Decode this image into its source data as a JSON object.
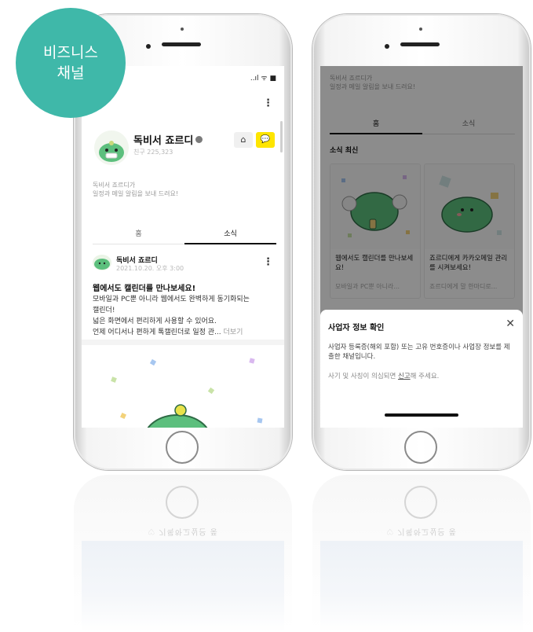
{
  "badge": {
    "line1": "비즈니스",
    "line2": "채널"
  },
  "left_phone": {
    "status_icons": "..ıl ᯤ ■",
    "menu_icon": "⋮",
    "channel": {
      "name": "독비서 죠르디",
      "friends": "친구 225,323",
      "home_button": "⌂",
      "chat_button": "💬"
    },
    "description": {
      "line1": "독비서 죠르디가",
      "line2": "일정과 메일 알림을 보내 드려요!"
    },
    "tabs": [
      "홈",
      "소식"
    ],
    "active_tab": "소식",
    "post": {
      "author": "독비서 죠르디",
      "date": "2021.10.20. 오후 3:00",
      "menu": "⋮",
      "title": "웹에서도 캘린더를 만나보세요!",
      "body_line1": "모바일과 PC뿐 아니라 웹에서도 완벽하게 동기화되는",
      "body_line2": "캘린더!",
      "body_line3": "넓은 화면에서 편리하게 사용할 수 있어요.",
      "body_line4": "언제 어디서나 편하게 톡캘린더로 일정 관...",
      "more": "더보기"
    }
  },
  "right_phone": {
    "description": {
      "line1": "독비서 죠르디가",
      "line2": "일정과 메일 알림을 보내 드려요!"
    },
    "tabs": [
      "홈",
      "소식"
    ],
    "active_tab": "홈",
    "section_title": "소식 최신",
    "cards": [
      {
        "title": "웹에서도 캘린더를 만나보세요!",
        "subtitle": "모바일과 PC뿐 아니라..."
      },
      {
        "title": "죠르디에게 카카오메일 관리를 시켜보세요!",
        "subtitle": "죠르디에게 말 한마디로..."
      }
    ],
    "sheet": {
      "title": "사업자 정보 확인",
      "close_icon": "✕",
      "text": "사업자 등록증(해외 포함) 또는 고유 번호증이나 사업장 정보를 제출한 채널입니다.",
      "note_prefix": "사기 및 사칭이 의심되면 ",
      "note_link": "신고",
      "note_suffix": "해 주세요."
    }
  },
  "reflection_text": "♡ 기록하고싶은 풍",
  "colors": {
    "badge": "#3fb8a9",
    "chat_button": "#fee500",
    "character_green": "#5cbf7d"
  }
}
